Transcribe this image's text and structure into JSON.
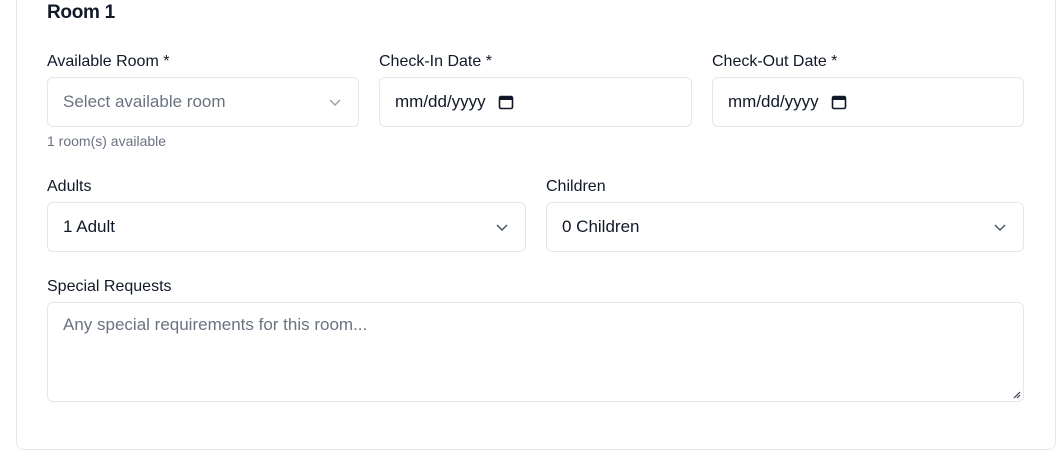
{
  "section": {
    "title": "Room 1"
  },
  "room": {
    "label": "Available Room *",
    "placeholder": "Select available room",
    "helper": "1 room(s) available"
  },
  "checkin": {
    "label": "Check-In Date *",
    "value": "mm/dd/yyyy"
  },
  "checkout": {
    "label": "Check-Out Date *",
    "value": "mm/dd/yyyy"
  },
  "adults": {
    "label": "Adults",
    "value": "1 Adult"
  },
  "children": {
    "label": "Children",
    "value": "0 Children"
  },
  "requests": {
    "label": "Special Requests",
    "placeholder": "Any special requirements for this room..."
  },
  "icons": {
    "chevron": "chevron-down-icon",
    "calendar": "calendar-icon",
    "resize": "resize-handle-icon"
  }
}
